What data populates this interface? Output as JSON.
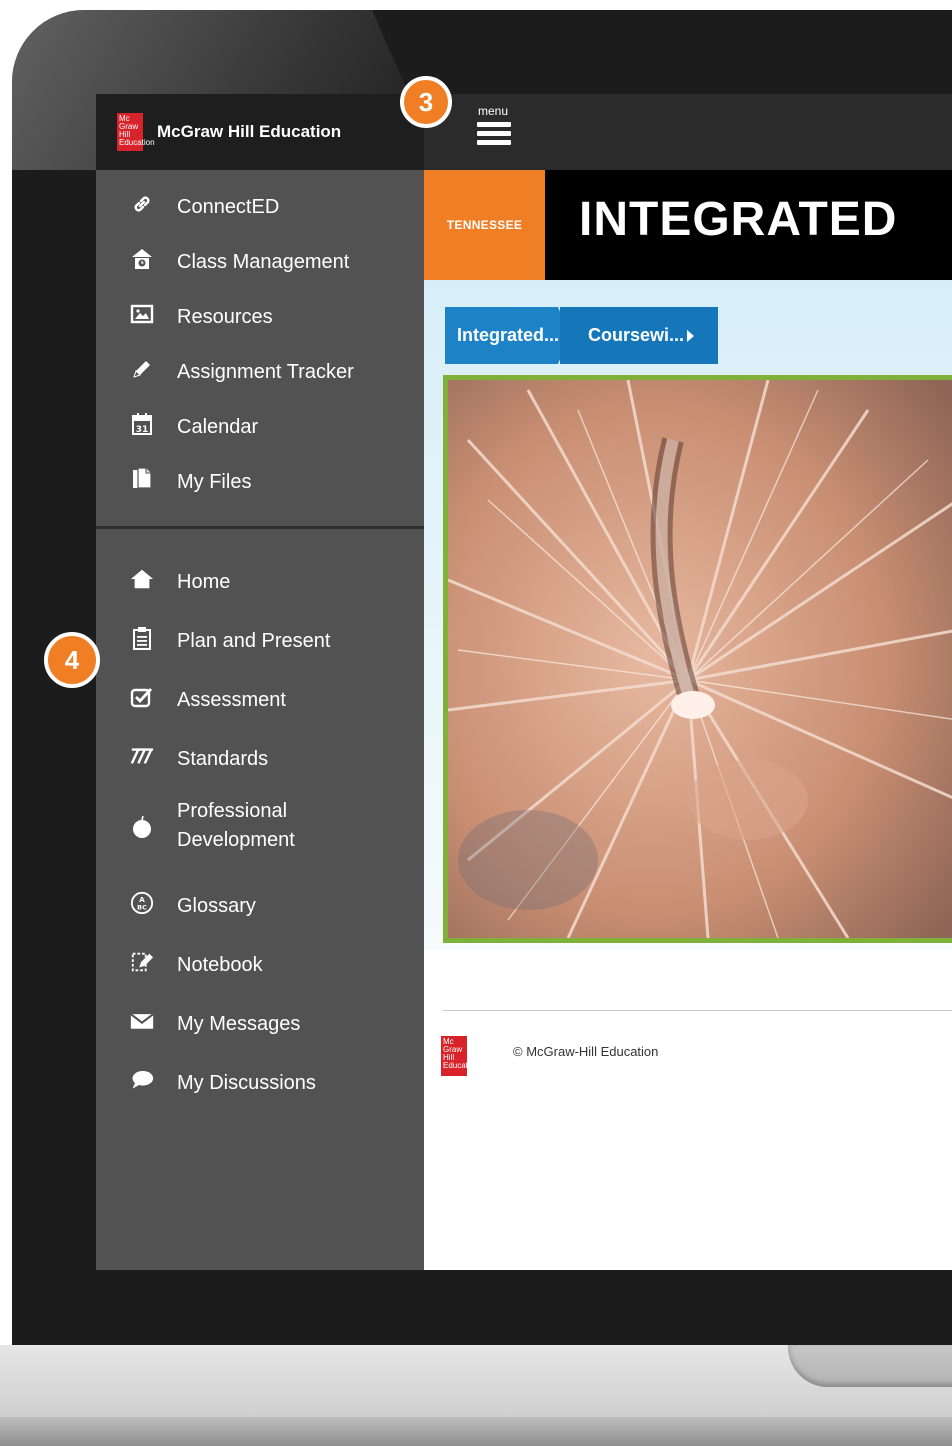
{
  "brand": {
    "logo_text": "Mc Graw Hill Education",
    "name": "McGraw Hill Education"
  },
  "menu": {
    "label": "menu"
  },
  "sidebar": {
    "top_items": [
      {
        "label": "ConnectED",
        "icon": "link-icon"
      },
      {
        "label": "Class Management",
        "icon": "class-management-icon"
      },
      {
        "label": "Resources",
        "icon": "image-icon"
      },
      {
        "label": "Assignment Tracker",
        "icon": "pencil-icon"
      },
      {
        "label": "Calendar",
        "icon": "calendar-icon"
      },
      {
        "label": "My Files",
        "icon": "files-icon"
      }
    ],
    "bottom_items": [
      {
        "label": "Home",
        "icon": "home-icon"
      },
      {
        "label": "Plan and Present",
        "icon": "clipboard-icon"
      },
      {
        "label": "Assessment",
        "icon": "checkbox-icon"
      },
      {
        "label": "Standards",
        "icon": "standards-icon"
      },
      {
        "label": "Professional Development",
        "icon": "apple-icon"
      },
      {
        "label": "Glossary",
        "icon": "abc-icon"
      },
      {
        "label": "Notebook",
        "icon": "notebook-icon"
      },
      {
        "label": "My Messages",
        "icon": "envelope-icon"
      },
      {
        "label": "My Discussions",
        "icon": "chat-bubble-icon"
      }
    ]
  },
  "header": {
    "state": "TENNESSEE",
    "title": "INTEGRATED"
  },
  "breadcrumb": [
    "Integrated...",
    "Coursewi..."
  ],
  "footer": {
    "logo_text": "Mc Graw Hill Education",
    "copyright": "© McGraw-Hill Education"
  },
  "callouts": {
    "menu_number": "3",
    "sidebar_number": "4"
  },
  "colors": {
    "accent_orange": "#f07e24",
    "brand_red": "#d8232a",
    "breadcrumb_blue": "#1e82c6",
    "image_border_green": "#7fb13a",
    "sidebar_gray": "#525252"
  }
}
